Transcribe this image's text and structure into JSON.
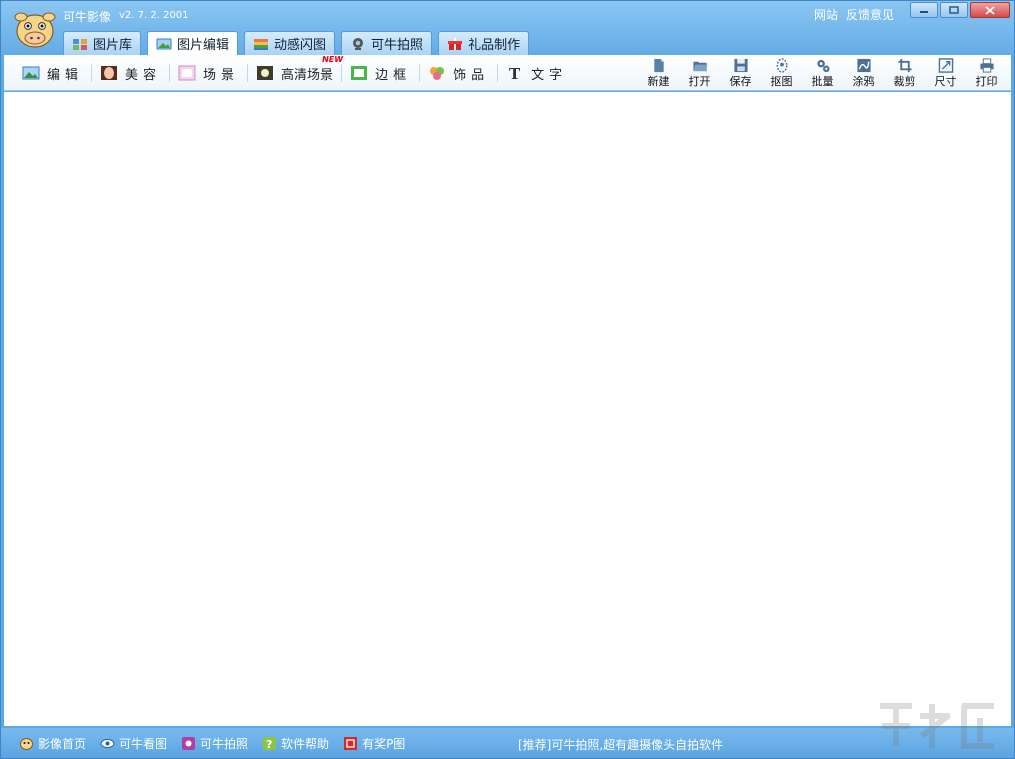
{
  "window": {
    "title": "可牛影像",
    "version": "v2. 7. 2. 2001",
    "links": [
      "网站",
      "反馈意见"
    ]
  },
  "tabs": [
    {
      "label": "图片库",
      "icon": "photo-library-icon"
    },
    {
      "label": "图片编辑",
      "icon": "photo-edit-icon"
    },
    {
      "label": "动感闪图",
      "icon": "animation-icon"
    },
    {
      "label": "可牛拍照",
      "icon": "webcam-icon"
    },
    {
      "label": "礼品制作",
      "icon": "gift-icon"
    }
  ],
  "toolbar": {
    "left": [
      {
        "label": "编辑",
        "icon": "landscape-icon"
      },
      {
        "label": "美容",
        "icon": "face-icon"
      },
      {
        "label": "场景",
        "icon": "scene-icon"
      },
      {
        "label": "高清场景",
        "icon": "hd-scene-icon",
        "badge": "NEW"
      },
      {
        "label": "边框",
        "icon": "frame-icon"
      },
      {
        "label": "饰品",
        "icon": "clover-icon"
      },
      {
        "label": "文字",
        "icon": "text-icon"
      }
    ],
    "right": [
      {
        "label": "新建",
        "icon": "new-file-icon"
      },
      {
        "label": "打开",
        "icon": "open-folder-icon"
      },
      {
        "label": "保存",
        "icon": "save-icon"
      },
      {
        "label": "抠图",
        "icon": "cutout-icon"
      },
      {
        "label": "批量",
        "icon": "batch-gear-icon"
      },
      {
        "label": "涂鸦",
        "icon": "doodle-icon"
      },
      {
        "label": "裁剪",
        "icon": "crop-icon"
      },
      {
        "label": "尺寸",
        "icon": "resize-icon"
      },
      {
        "label": "打印",
        "icon": "print-icon"
      }
    ]
  },
  "statusbar": {
    "links": [
      {
        "label": "影像首页",
        "icon": "cow-home-icon"
      },
      {
        "label": "可牛看图",
        "icon": "eye-icon"
      },
      {
        "label": "可牛拍照",
        "icon": "camera-icon"
      },
      {
        "label": "软件帮助",
        "icon": "help-icon"
      },
      {
        "label": "有奖P图",
        "icon": "award-icon"
      }
    ],
    "promo": "[推荐]可牛拍照,超有趣摄像头自拍软件"
  },
  "colors": {
    "frame": "#5fa9e2",
    "canvas": "#ffffff",
    "badge": "#e01111"
  }
}
